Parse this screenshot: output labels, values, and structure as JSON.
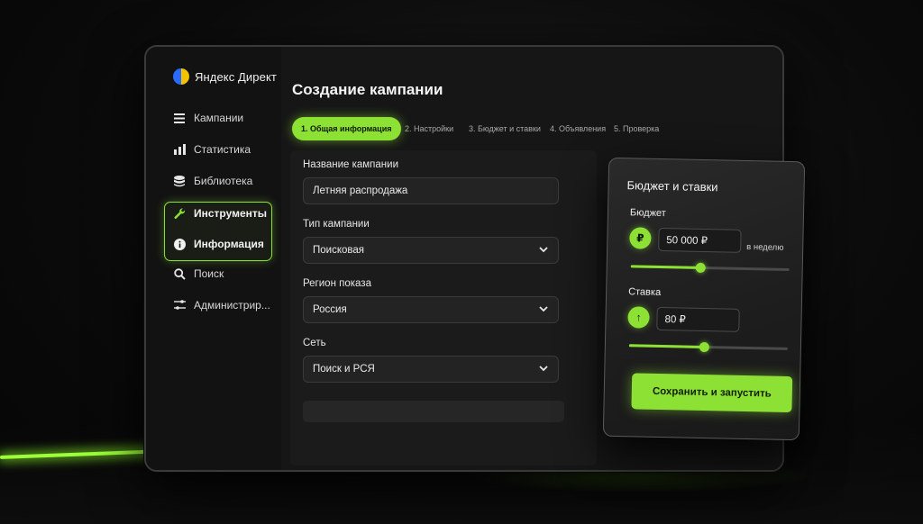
{
  "app": {
    "logo_text": "Яндекс Директ"
  },
  "sidebar": {
    "items": [
      {
        "label": "Кампании",
        "icon": "menu-list-icon"
      },
      {
        "label": "Статистика",
        "icon": "bar-chart-icon"
      },
      {
        "label": "Библиотека",
        "icon": "database-icon"
      },
      {
        "label": "Инструменты",
        "icon": "wrench-icon"
      },
      {
        "label": "Информация",
        "icon": "info-icon"
      },
      {
        "label": "Поиск",
        "icon": "search-icon"
      },
      {
        "label": "Администрир...",
        "icon": "settings-sliders-icon"
      }
    ]
  },
  "main": {
    "title": "Создание кампании",
    "tabs": [
      {
        "label": "1. Общая информация",
        "active": true
      },
      {
        "label": "2. Настройки",
        "active": false
      },
      {
        "label": "3. Бюджет и ставки",
        "active": false
      },
      {
        "label": "4. Объявления",
        "active": false
      },
      {
        "label": "5. Проверка",
        "active": false
      }
    ],
    "form": {
      "name_label": "Название кампании",
      "name_value": "Летняя распродажа",
      "type_label": "Тип кампании",
      "type_value": "Поисковая",
      "region_label": "Регион показа",
      "region_value": "Россия",
      "network_label": "Сеть",
      "network_value": "Поиск и РСЯ"
    }
  },
  "budget_card": {
    "title": "Бюджет и ставки",
    "budget_label": "Бюджет",
    "budget_icon": "₽",
    "budget_value": "50 000 ₽",
    "budget_period": "в неделю",
    "budget_slider_fraction": 0.44,
    "bid_label": "Ставка",
    "bid_icon": "↑",
    "bid_value": "80 ₽",
    "bid_slider_fraction": 0.47,
    "save_button": "Сохранить и запустить"
  },
  "colors": {
    "accent": "#8ce134",
    "background": "#0a0a0a",
    "panel": "#161616"
  }
}
